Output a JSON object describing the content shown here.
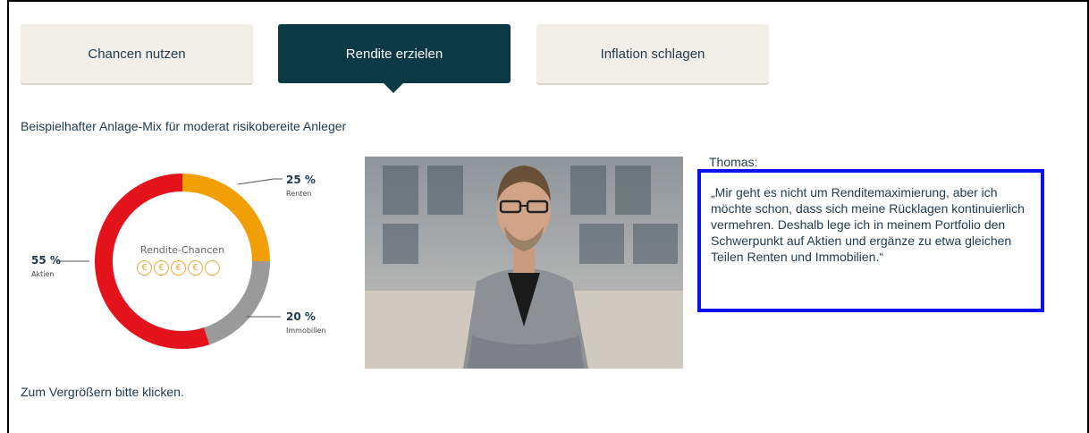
{
  "tabs": [
    {
      "label": "Chancen nutzen",
      "active": false
    },
    {
      "label": "Rendite erzielen",
      "active": true
    },
    {
      "label": "Inflation schlagen",
      "active": false
    }
  ],
  "subtitle": "Beispielhafter Anlage-Mix für moderat risikobereite Anleger",
  "chart_data": {
    "type": "pie",
    "categories": [
      "Renten",
      "Immobilien",
      "Aktien"
    ],
    "values": [
      25,
      20,
      55
    ],
    "labels": [
      "25 %",
      "20 %",
      "55 %"
    ],
    "colors": [
      "#f29f05",
      "#9a9a9a",
      "#e3121b"
    ],
    "center_title": "Rendite-Chancen",
    "center_icons": {
      "filled": 4,
      "total": 5,
      "symbol": "€"
    }
  },
  "person": {
    "name": "Thomas:",
    "quote": "„Mir geht es nicht um Renditemaximierung, aber ich möchte schon, dass sich meine Rücklagen kontinuierlich vermehren. Deshalb lege ich in meinem Portfolio den Schwerpunkt auf Aktien und ergänze zu etwa gleichen Teilen Renten und Immobilien.“"
  },
  "footer_note": "Zum Vergrößern bitte klicken.",
  "icons": [
    "euro-coin-icon",
    "person-photo"
  ],
  "colors": {
    "tab_active": "#0b3a46",
    "tab_inactive": "#f2efe9",
    "highlight_border": "#0a12f0"
  }
}
